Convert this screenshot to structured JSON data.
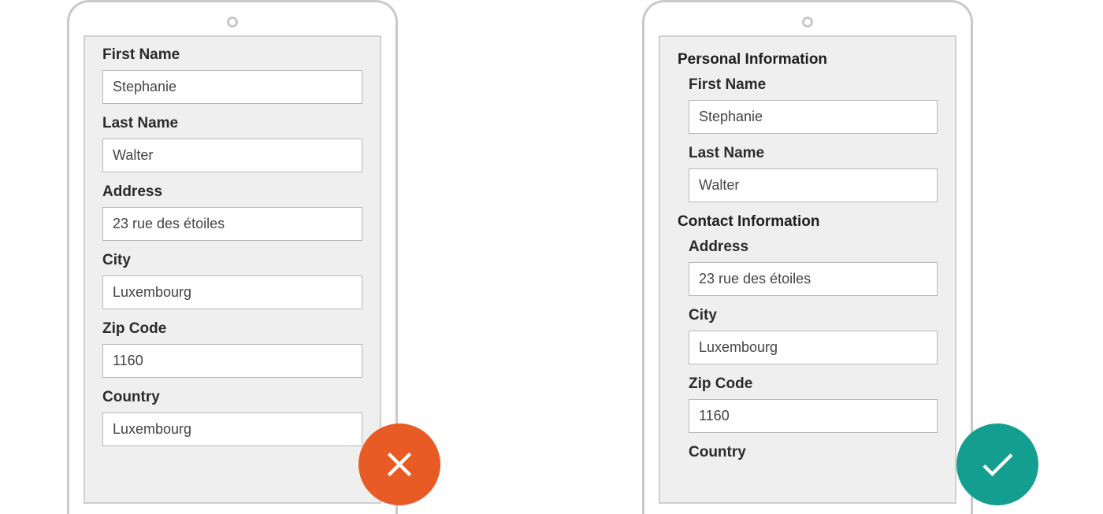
{
  "left": {
    "fields": [
      {
        "label": "First Name",
        "value": "Stephanie"
      },
      {
        "label": "Last Name",
        "value": "Walter"
      },
      {
        "label": "Address",
        "value": "23 rue des étoiles"
      },
      {
        "label": "City",
        "value": "Luxembourg"
      },
      {
        "label": "Zip Code",
        "value": "1160"
      },
      {
        "label": "Country",
        "value": "Luxembourg"
      }
    ]
  },
  "right": {
    "sections": [
      {
        "title": "Personal Information",
        "fields": [
          {
            "label": "First Name",
            "value": "Stephanie"
          },
          {
            "label": "Last Name",
            "value": "Walter"
          }
        ]
      },
      {
        "title": "Contact Information",
        "fields": [
          {
            "label": "Address",
            "value": "23 rue des étoiles"
          },
          {
            "label": "City",
            "value": "Luxembourg"
          },
          {
            "label": "Zip Code",
            "value": "1160"
          },
          {
            "label": "Country",
            "value": ""
          }
        ]
      }
    ]
  },
  "badges": {
    "cross_color": "#e85b25",
    "check_color": "#149e8f"
  }
}
